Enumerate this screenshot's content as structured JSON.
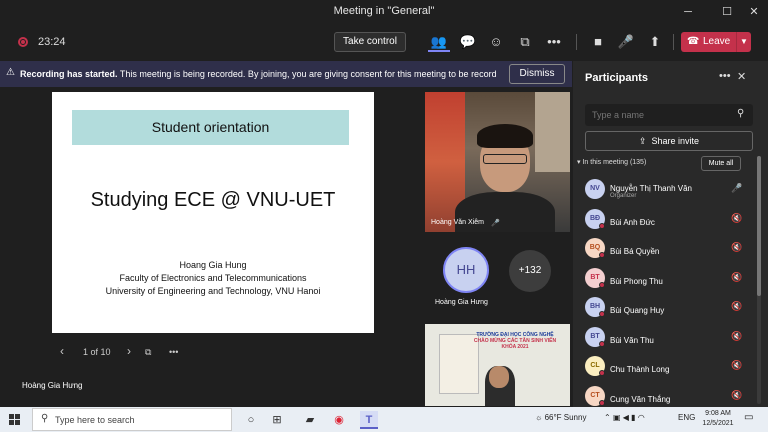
{
  "window": {
    "title": "Meeting in \"General\"",
    "minimize": "─",
    "maximize": "☐",
    "close": "✕"
  },
  "toolbar": {
    "timer": "23:24",
    "take_control": "Take control",
    "leave": "Leave",
    "icons": [
      "people-icon",
      "chat-icon",
      "reactions-icon",
      "rooms-icon",
      "more-icon",
      "camera-icon",
      "mic-icon",
      "share-icon"
    ]
  },
  "banner": {
    "bold": "Recording has started.",
    "text": " This meeting is being recorded. By joining, you are giving consent for this meeting to be recorded. Pri...",
    "dismiss": "Dismiss"
  },
  "slide": {
    "heading": "Student orientation",
    "title": "Studying ECE @ VNU-UET",
    "lines": [
      "Hoang Gia Hung",
      "Faculty of Electronics and Telecommunications",
      "University of Engineering and Technology, VNU Hanoi"
    ]
  },
  "pager": {
    "label": "1 of 10",
    "prev": "‹",
    "next": "›"
  },
  "presenter": "Hoàng Gia Hưng",
  "tiles": {
    "video_name": "Hoàng Văn Xiêm",
    "avatar_initials": "HH",
    "avatar_name": "Hoàng Gia Hưng",
    "more_count": "+132",
    "sign_line1": "TRƯỜNG ĐẠI HỌC CÔNG NGHỆ",
    "sign_line2": "CHÀO MỪNG CÁC TÂN SINH VIÊN",
    "sign_line3": "KHÓA 2021"
  },
  "participants": {
    "title": "Participants",
    "search_placeholder": "Type a name",
    "share_invite": "Share invite",
    "section": "In this meeting (135)",
    "mute_all": "Mute all",
    "people": [
      {
        "initials": "NV",
        "name": "Nguyễn Thị Thanh Vân",
        "role": "Organizer",
        "bg": "#c8d1f0",
        "fg": "#444791",
        "muted": false
      },
      {
        "initials": "BĐ",
        "name": "Bùi Anh Đức",
        "role": "",
        "bg": "#c8d1f0",
        "fg": "#444791",
        "muted": true
      },
      {
        "initials": "BQ",
        "name": "Bùi Bá Quyền",
        "role": "",
        "bg": "#f7d7c4",
        "fg": "#b54e1e",
        "muted": true
      },
      {
        "initials": "BT",
        "name": "Bùi Phong Thu",
        "role": "",
        "bg": "#f4cfd0",
        "fg": "#c4314b",
        "muted": true
      },
      {
        "initials": "BH",
        "name": "Bùi Quang Huy",
        "role": "",
        "bg": "#c8d1f0",
        "fg": "#444791",
        "muted": true
      },
      {
        "initials": "BT",
        "name": "Bùi Văn Thu",
        "role": "",
        "bg": "#c8d1f0",
        "fg": "#444791",
        "muted": true
      },
      {
        "initials": "CL",
        "name": "Chu Thành Long",
        "role": "",
        "bg": "#fbeec0",
        "fg": "#8a6a00",
        "muted": true
      },
      {
        "initials": "CT",
        "name": "Cung Văn Thắng",
        "role": "",
        "bg": "#f7d7c4",
        "fg": "#b54e1e",
        "muted": true
      }
    ]
  },
  "taskbar": {
    "search_placeholder": "Type here to search",
    "weather": "66°F  Sunny",
    "lang": "ENG",
    "time": "9:08 AM",
    "date": "12/5/2021"
  }
}
